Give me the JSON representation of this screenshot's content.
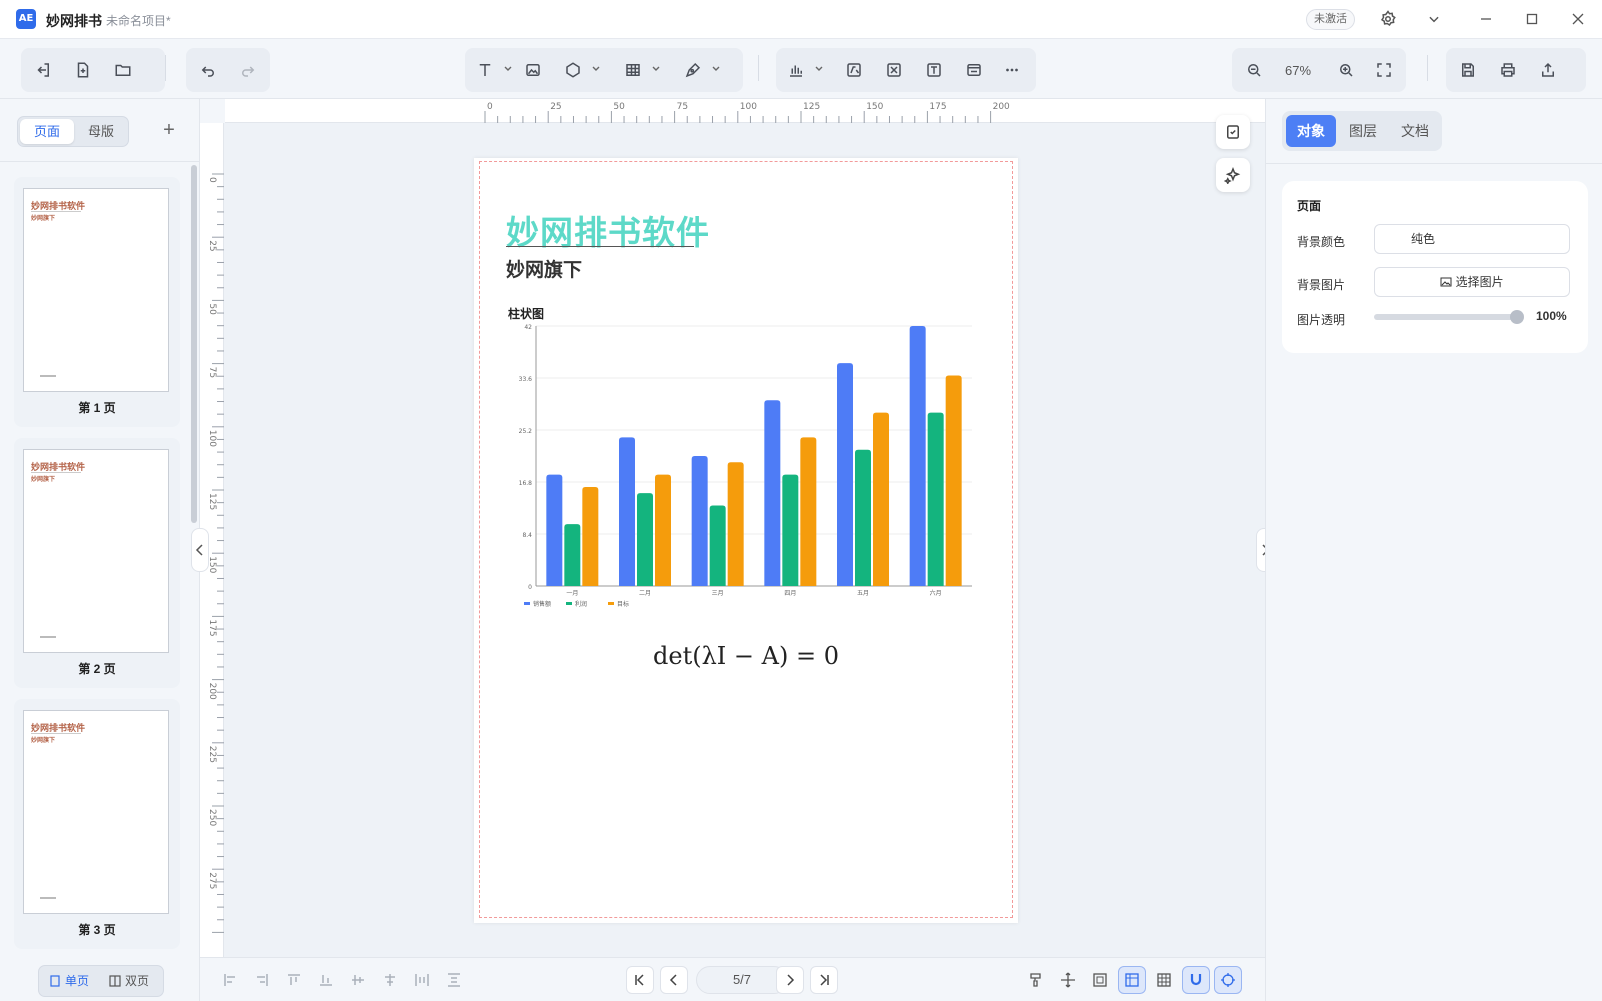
{
  "titlebar": {
    "app_name": "妙网排书",
    "project_name": "未命名项目*",
    "activate_label": "未激活"
  },
  "toolbar": {
    "zoom_level": "67%"
  },
  "left_panel": {
    "tabs": [
      "页面",
      "母版"
    ],
    "thumbnails": [
      {
        "title": "妙网排书软件",
        "subtitle": "妙网旗下",
        "label": "第 1 页"
      },
      {
        "title": "妙网排书软件",
        "subtitle": "妙网旗下",
        "label": "第 2 页"
      },
      {
        "title": "妙网排书软件",
        "subtitle": "妙网旗下",
        "label": "第 3 页"
      }
    ],
    "view_modes": [
      "单页",
      "双页"
    ]
  },
  "rulers": {
    "horizontal": [
      "0",
      "25",
      "50",
      "75",
      "100",
      "125",
      "150",
      "175",
      "200"
    ],
    "vertical": [
      "0",
      "25",
      "50",
      "75",
      "100",
      "125",
      "150",
      "175",
      "200",
      "225",
      "250",
      "275"
    ]
  },
  "page": {
    "title": "妙网排书软件",
    "subtitle": "妙网旗下",
    "formula": "det(λI − A) = 0"
  },
  "chart_data": {
    "type": "bar",
    "title": "柱状图",
    "categories": [
      "一月",
      "二月",
      "三月",
      "四月",
      "五月",
      "六月"
    ],
    "series": [
      {
        "name": "销售额",
        "color": "#4e7cf6",
        "values": [
          18,
          24,
          21,
          30,
          36,
          42
        ]
      },
      {
        "name": "利润",
        "color": "#14b47e",
        "values": [
          10,
          15,
          13,
          18,
          22,
          28
        ]
      },
      {
        "name": "目标",
        "color": "#f59c0c",
        "values": [
          16,
          18,
          20,
          24,
          28,
          34
        ]
      }
    ],
    "yticks": [
      "0",
      "8.4",
      "16.8",
      "25.2",
      "33.6",
      "42"
    ],
    "ylim": [
      0,
      42
    ],
    "legend": "bottom-left"
  },
  "bottombar": {
    "page_indicator": "5/7"
  },
  "right_panel": {
    "tabs": [
      "对象",
      "图层",
      "文档"
    ],
    "section_title": "页面",
    "bg_color_label": "背景颜色",
    "bg_color_value": "纯色",
    "bg_image_label": "背景图片",
    "bg_image_button": "选择图片",
    "opacity_label": "图片透明",
    "opacity_value": "100%",
    "opacity_fraction": 1.0
  }
}
